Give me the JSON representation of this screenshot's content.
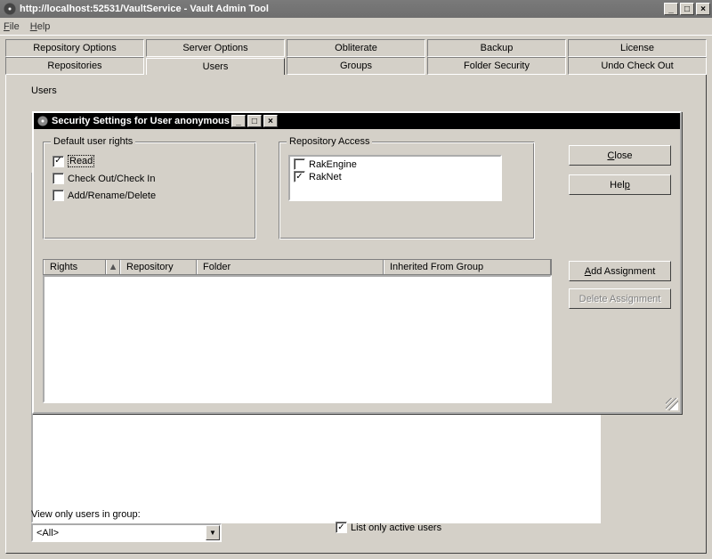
{
  "window": {
    "title": "http://localhost:52531/VaultService - Vault Admin Tool"
  },
  "menu": {
    "file": "File",
    "help": "Help"
  },
  "tabs_row1": [
    "Repository Options",
    "Server Options",
    "Obliterate",
    "Backup",
    "License"
  ],
  "tabs_row2": [
    "Repositories",
    "Users",
    "Groups",
    "Folder Security",
    "Undo Check Out"
  ],
  "active_tab": "Users",
  "users_label": "Users",
  "filter": {
    "label": "View only users in group:",
    "value": "<All>",
    "list_active_label": "List only active users",
    "list_active_checked": true
  },
  "dialog": {
    "title": "Security Settings for User anonymous",
    "default_rights_legend": "Default user rights",
    "rights": {
      "read": {
        "label": "Read",
        "checked": true
      },
      "checkout": {
        "label": "Check Out/Check In",
        "checked": false
      },
      "modify": {
        "label": "Add/Rename/Delete",
        "checked": false
      }
    },
    "repo_access_legend": "Repository Access",
    "repos": [
      {
        "name": "RakEngine",
        "checked": false
      },
      {
        "name": "RakNet",
        "checked": true
      }
    ],
    "buttons": {
      "close": "Close",
      "help": "Help",
      "add": "Add Assignment",
      "delete": "Delete Assignment"
    },
    "columns": {
      "rights": "Rights",
      "repository": "Repository",
      "folder": "Folder",
      "inherited": "Inherited From Group"
    }
  }
}
